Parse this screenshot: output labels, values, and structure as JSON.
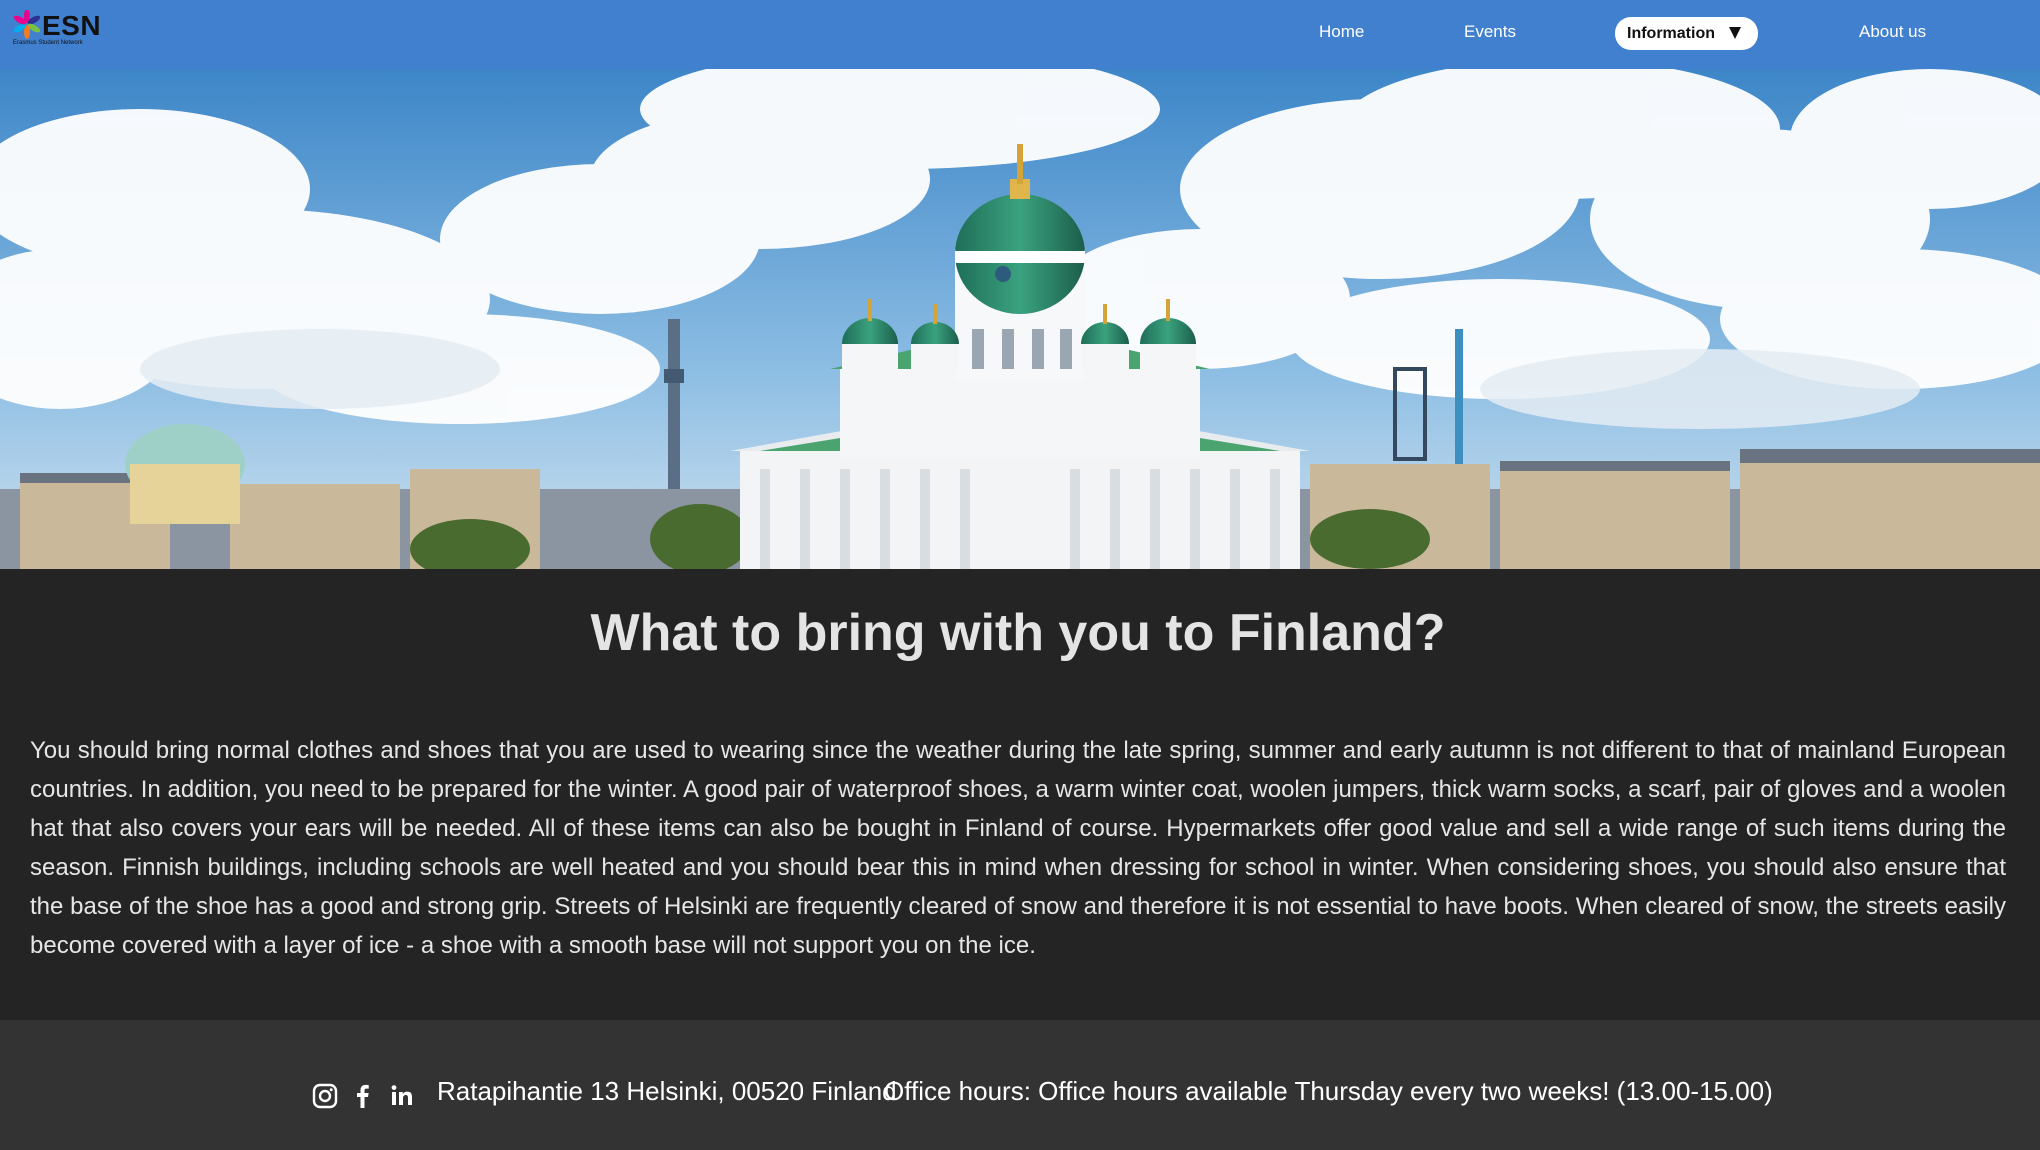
{
  "header": {
    "logo_text": "ESN",
    "logo_subtitle": "Erasmus Student Network",
    "nav": {
      "home": "Home",
      "events": "Events",
      "information": "Information",
      "about": "About us"
    },
    "dropdown_icon": "triangle-down-icon"
  },
  "hero": {
    "image": "helsinki-cathedral-skyline"
  },
  "main": {
    "title": "What to bring with you to Finland?",
    "paragraph": "You should bring normal clothes and shoes that you are used to wearing since the weather during the late spring, summer and early autumn is not different to that of mainland European countries. In addition, you need to be prepared for the winter. A good pair of waterproof shoes, a warm winter coat, woolen jumpers, thick warm socks, a scarf, pair of gloves and a woolen hat that also covers your ears will be needed. All of these items can also be bought in Finland of course. Hypermarkets offer good value and sell a wide range of such items during the season. Finnish buildings, including schools are well heated and you should bear this in mind when dressing for school in winter. When considering shoes, you should also ensure that the base of the shoe has a good and strong grip. Streets of Helsinki are frequently cleared of snow and therefore it is not essential to have boots. When cleared of snow, the streets easily become covered with a layer of ice - a shoe with a smooth base will not support you on the ice."
  },
  "footer": {
    "social_icons": [
      "instagram-icon",
      "facebook-icon",
      "linkedin-icon"
    ],
    "address": "Ratapihantie 13 Helsinki, 00520 Finland",
    "office_hours": "Office hours: Office hours available Thursday every two weeks! (13.00-15.00)"
  },
  "colors": {
    "navbar": "#4180cf",
    "page_background": "#242424",
    "footer_background": "#333333",
    "text": "#e6e6e6"
  }
}
